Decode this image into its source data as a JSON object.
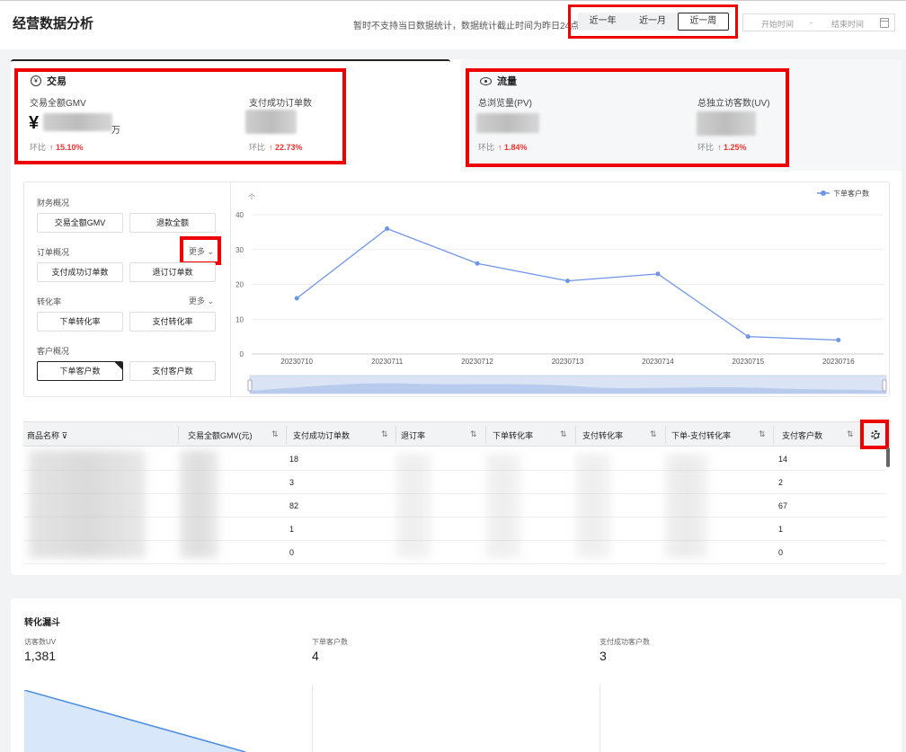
{
  "header": {
    "title": "经营数据分析",
    "notice": "暂时不支持当日数据统计，数据统计截止时间为昨日24点",
    "ranges": [
      "近一年",
      "近一月",
      "近一周"
    ],
    "active_range": "近一周",
    "start_placeholder": "开始时间",
    "range_sep": "-",
    "end_placeholder": "结束时间"
  },
  "trade": {
    "title": "交易",
    "gmv_label": "交易全额GMV",
    "gmv_prefix": "¥",
    "gmv_unit": "万",
    "gmv_cmp_label": "环比",
    "gmv_cmp_value": "↑ 15.10%",
    "orders_label": "支付成功订单数",
    "orders_cmp_label": "环比",
    "orders_cmp_value": "↑ 22.73%"
  },
  "flow": {
    "title": "流量",
    "pv_label": "总浏览量(PV)",
    "pv_cmp_label": "环比",
    "pv_cmp_value": "↑ 1.84%",
    "uv_label": "总独立访客数(UV)",
    "uv_cmp_label": "环比",
    "uv_cmp_value": "↑ 1.25%"
  },
  "selector": {
    "finance_title": "财务概况",
    "finance_items": [
      "交易全额GMV",
      "退款全额"
    ],
    "order_title": "订单概况",
    "order_more": "更多 ⌄",
    "order_items": [
      "支付成功订单数",
      "退订订单数"
    ],
    "conv_title": "转化率",
    "conv_more": "更多 ⌄",
    "conv_items": [
      "下单转化率",
      "支付转化率"
    ],
    "customer_title": "客户概况",
    "customer_items": [
      "下单客户数",
      "支付客户数"
    ],
    "active_item": "下单客户数"
  },
  "chart_data": {
    "type": "line",
    "x": [
      "20230710",
      "20230711",
      "20230712",
      "20230713",
      "20230714",
      "20230715",
      "20230716"
    ],
    "series": [
      {
        "name": "下单客户数",
        "values": [
          16,
          36,
          26,
          21,
          23,
          5,
          4
        ]
      }
    ],
    "yticks": [
      0,
      10,
      20,
      30,
      40
    ],
    "ylim": [
      0,
      40
    ],
    "ylabel_symbol": "个",
    "grid": true,
    "legend": "top-right",
    "color": "#6f95e8"
  },
  "table": {
    "columns": [
      "商品名称",
      "交易全额GMV(元)",
      "支付成功订单数",
      "退订率",
      "下单转化率",
      "支付转化率",
      "下单-支付转化率",
      "支付客户数"
    ],
    "rows": [
      {
        "orders": "18",
        "customers": "14"
      },
      {
        "orders": "3",
        "customers": "2"
      },
      {
        "orders": "82",
        "customers": "67"
      },
      {
        "orders": "1",
        "customers": "1"
      },
      {
        "orders": "0",
        "customers": "0"
      }
    ]
  },
  "funnel": {
    "title": "转化漏斗",
    "stages": [
      {
        "label": "访客数UV",
        "value": "1,381"
      },
      {
        "label": "下单客户数",
        "value": "4"
      },
      {
        "label": "支付成功客户数",
        "value": "3"
      }
    ]
  }
}
